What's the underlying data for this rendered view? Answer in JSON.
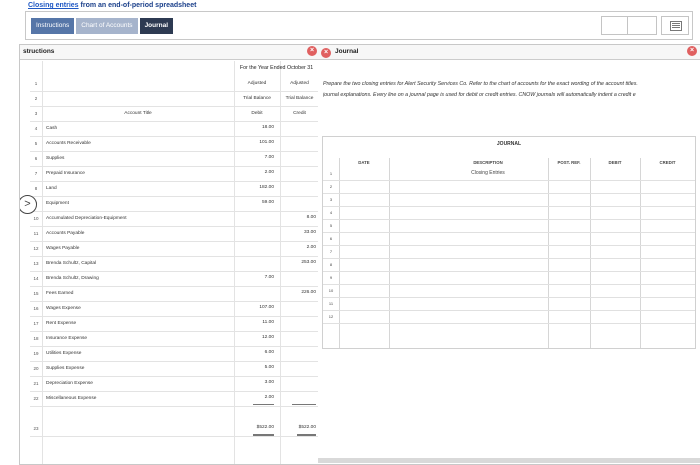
{
  "header": {
    "link_text": "Closing entries",
    "rest_text": " from an end-of-period spreadsheet"
  },
  "tabs": [
    {
      "label": "Instructions"
    },
    {
      "label": "Chart of Accounts"
    },
    {
      "label": "Journal"
    }
  ],
  "left_panel": {
    "title": "structions",
    "period": "For the Year Ended October 31",
    "col_adjusted": "Adjusted",
    "col_trial_balance": "Trial Balance",
    "col_account_title": "Account Title",
    "col_debit": "Debit",
    "col_credit": "Credit",
    "accounts": [
      {
        "n": "4",
        "name": "Cash",
        "debit": "18.00",
        "credit": ""
      },
      {
        "n": "5",
        "name": "Accounts Receivable",
        "debit": "101.00",
        "credit": ""
      },
      {
        "n": "6",
        "name": "Supplies",
        "debit": "7.00",
        "credit": ""
      },
      {
        "n": "7",
        "name": "Prepaid Insurance",
        "debit": "2.00",
        "credit": ""
      },
      {
        "n": "8",
        "name": "Land",
        "debit": "182.00",
        "credit": ""
      },
      {
        "n": "9",
        "name": "Equipment",
        "debit": "59.00",
        "credit": ""
      },
      {
        "n": "10",
        "name": "Accumulated Depreciation-Equipment",
        "debit": "",
        "credit": "8.00"
      },
      {
        "n": "11",
        "name": "Accounts Payable",
        "debit": "",
        "credit": "33.00"
      },
      {
        "n": "12",
        "name": "Wages Payable",
        "debit": "",
        "credit": "2.00"
      },
      {
        "n": "13",
        "name": "Brenda Schultz, Capital",
        "debit": "",
        "credit": "253.00"
      },
      {
        "n": "14",
        "name": "Brenda Schultz, Drawing",
        "debit": "7.00",
        "credit": ""
      },
      {
        "n": "15",
        "name": "Fees Earned",
        "debit": "",
        "credit": "226.00"
      },
      {
        "n": "16",
        "name": "Wages Expense",
        "debit": "107.00",
        "credit": ""
      },
      {
        "n": "17",
        "name": "Rent Expense",
        "debit": "11.00",
        "credit": ""
      },
      {
        "n": "18",
        "name": "Insurance Expense",
        "debit": "12.00",
        "credit": ""
      },
      {
        "n": "19",
        "name": "Utilities Expense",
        "debit": "6.00",
        "credit": ""
      },
      {
        "n": "20",
        "name": "Supplies Expense",
        "debit": "5.00",
        "credit": ""
      },
      {
        "n": "21",
        "name": "Depreciation Expense",
        "debit": "3.00",
        "credit": ""
      },
      {
        "n": "22",
        "name": "Miscellaneous Expense",
        "debit": "2.00",
        "credit": ""
      }
    ],
    "total_n": "23",
    "total_debit": "$522.00",
    "total_credit": "$522.00",
    "row_numbers": [
      "1",
      "2",
      "3"
    ]
  },
  "right_panel": {
    "title": "Journal",
    "instructions_line1": "Prepare the two closing entries for Alert Security Services Co. Refer to the chart of accounts for the exact wording of the account titles.",
    "instructions_line2": "journal explanations. Every line on a journal page is used for debit or credit entries. CNOW journals will automatically indent a credit e",
    "journal": {
      "title": "JOURNAL",
      "headers": {
        "date": "DATE",
        "description": "DESCRIPTION",
        "post_ref": "POST. REF.",
        "debit": "DEBIT",
        "credit": "CREDIT"
      },
      "first_row_description": "Closing Entries",
      "row_numbers": [
        "1",
        "2",
        "3",
        "4",
        "5",
        "6",
        "7",
        "8",
        "9",
        "10",
        "11",
        "12"
      ]
    }
  }
}
